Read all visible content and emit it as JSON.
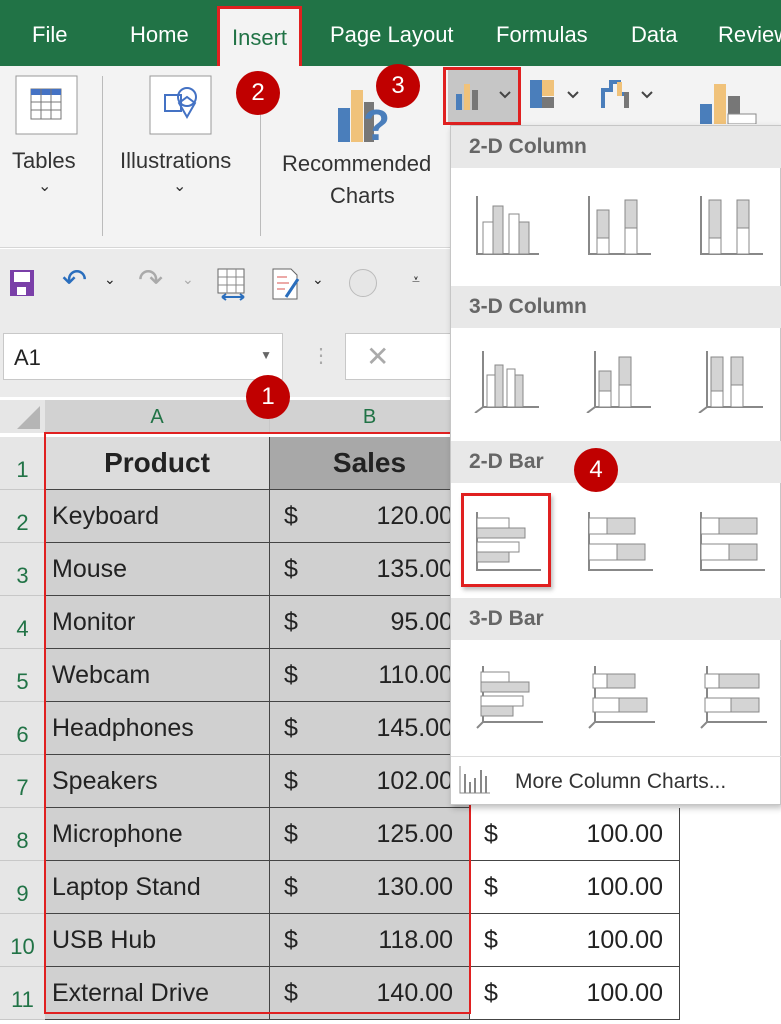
{
  "ribbon_tabs": [
    "File",
    "Home",
    "Insert",
    "Page Layout",
    "Formulas",
    "Data",
    "Review"
  ],
  "selected_tab": "Insert",
  "ribbon_groups": {
    "tables": "Tables",
    "illustrations": "Illustrations",
    "recommended_line1": "Recommended",
    "recommended_line2": "Charts"
  },
  "name_box": "A1",
  "columns": [
    "A",
    "B"
  ],
  "rows": [
    "1",
    "2",
    "3",
    "4",
    "5",
    "6",
    "7",
    "8",
    "9",
    "10",
    "11"
  ],
  "table": {
    "headers": [
      "Product",
      "Sales"
    ],
    "currency": "$",
    "data": [
      [
        "Keyboard",
        "120.00"
      ],
      [
        "Mouse",
        "135.00"
      ],
      [
        "Monitor",
        "95.00"
      ],
      [
        "Webcam",
        "110.00"
      ],
      [
        "Headphones",
        "145.00"
      ],
      [
        "Speakers",
        "102.00"
      ],
      [
        "Microphone",
        "125.00"
      ],
      [
        "Laptop Stand",
        "130.00"
      ],
      [
        "USB Hub",
        "118.00"
      ],
      [
        "External Drive",
        "140.00"
      ]
    ],
    "column_c_visible": [
      "100.00",
      "100.00",
      "100.00",
      "100.00"
    ]
  },
  "dropdown": {
    "sections": [
      "2-D Column",
      "3-D Column",
      "2-D Bar",
      "3-D Bar"
    ],
    "more": "More Column Charts..."
  },
  "badges": [
    "1",
    "2",
    "3",
    "4"
  ],
  "colors": {
    "excel_green": "#217346",
    "highlight_red": "#e02020",
    "badge_red": "#c00000",
    "selection_gray": "#d0d0d0"
  }
}
